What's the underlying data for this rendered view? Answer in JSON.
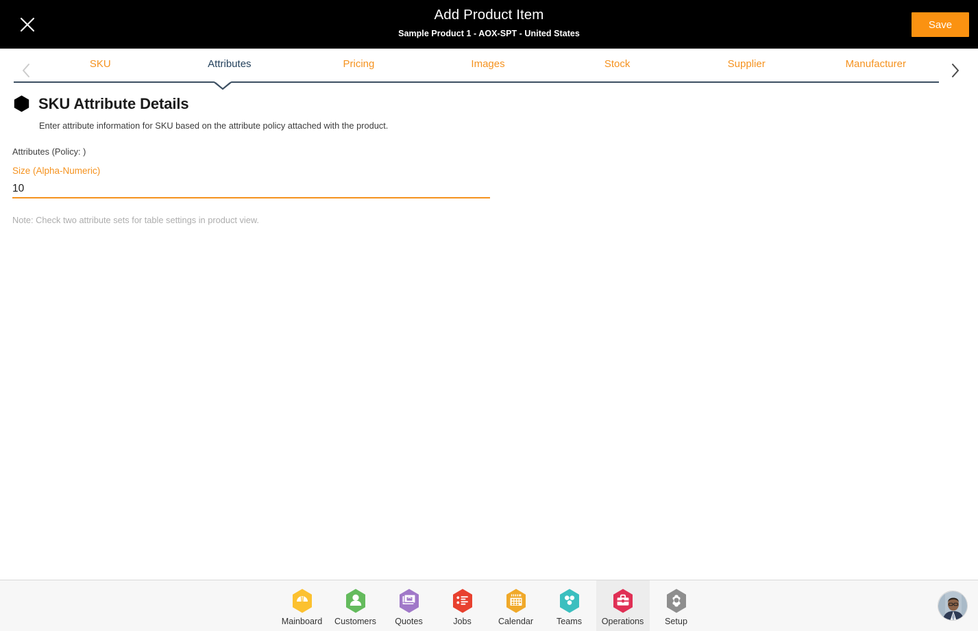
{
  "header": {
    "title": "Add Product Item",
    "subtitle": "Sample Product 1 - AOX-SPT - United States",
    "save_label": "Save",
    "close_icon": "close-icon",
    "background": "#000000",
    "save_color": "#fb9211"
  },
  "tabs": {
    "prev_icon": "chevron-left-icon",
    "next_icon": "chevron-right-icon",
    "active_index": 1,
    "items": [
      {
        "label": "SKU"
      },
      {
        "label": "Attributes"
      },
      {
        "label": "Pricing"
      },
      {
        "label": "Images"
      },
      {
        "label": "Stock"
      },
      {
        "label": "Supplier"
      },
      {
        "label": "Manufacturer"
      }
    ],
    "inactive_color": "#f5921e",
    "active_color": "#24415c"
  },
  "main": {
    "bullet_icon": "hexagon-icon",
    "section_title": "SKU Attribute Details",
    "section_description": "Enter attribute information for SKU based on the attribute policy attached with the product.",
    "policy_label": "Attributes (Policy: )",
    "attribute": {
      "label": "Size (Alpha-Numeric)",
      "value": "10",
      "placeholder": ""
    },
    "note": "Note: Check two attribute sets for table settings in product view."
  },
  "bottom_nav": {
    "active_index": 6,
    "items": [
      {
        "label": "Mainboard",
        "icon": "mainboard-icon",
        "color": "#fcc130"
      },
      {
        "label": "Customers",
        "icon": "customers-icon",
        "color": "#64bb5d"
      },
      {
        "label": "Quotes",
        "icon": "quotes-icon",
        "color": "#a078c8"
      },
      {
        "label": "Jobs",
        "icon": "jobs-icon",
        "color": "#e8412f"
      },
      {
        "label": "Calendar",
        "icon": "calendar-icon",
        "color": "#f0a92a"
      },
      {
        "label": "Teams",
        "icon": "teams-icon",
        "color": "#3bbfbf"
      },
      {
        "label": "Operations",
        "icon": "operations-icon",
        "color": "#e03055"
      },
      {
        "label": "Setup",
        "icon": "setup-icon",
        "color": "#8e8e8e"
      }
    ],
    "avatar": "user-avatar"
  }
}
